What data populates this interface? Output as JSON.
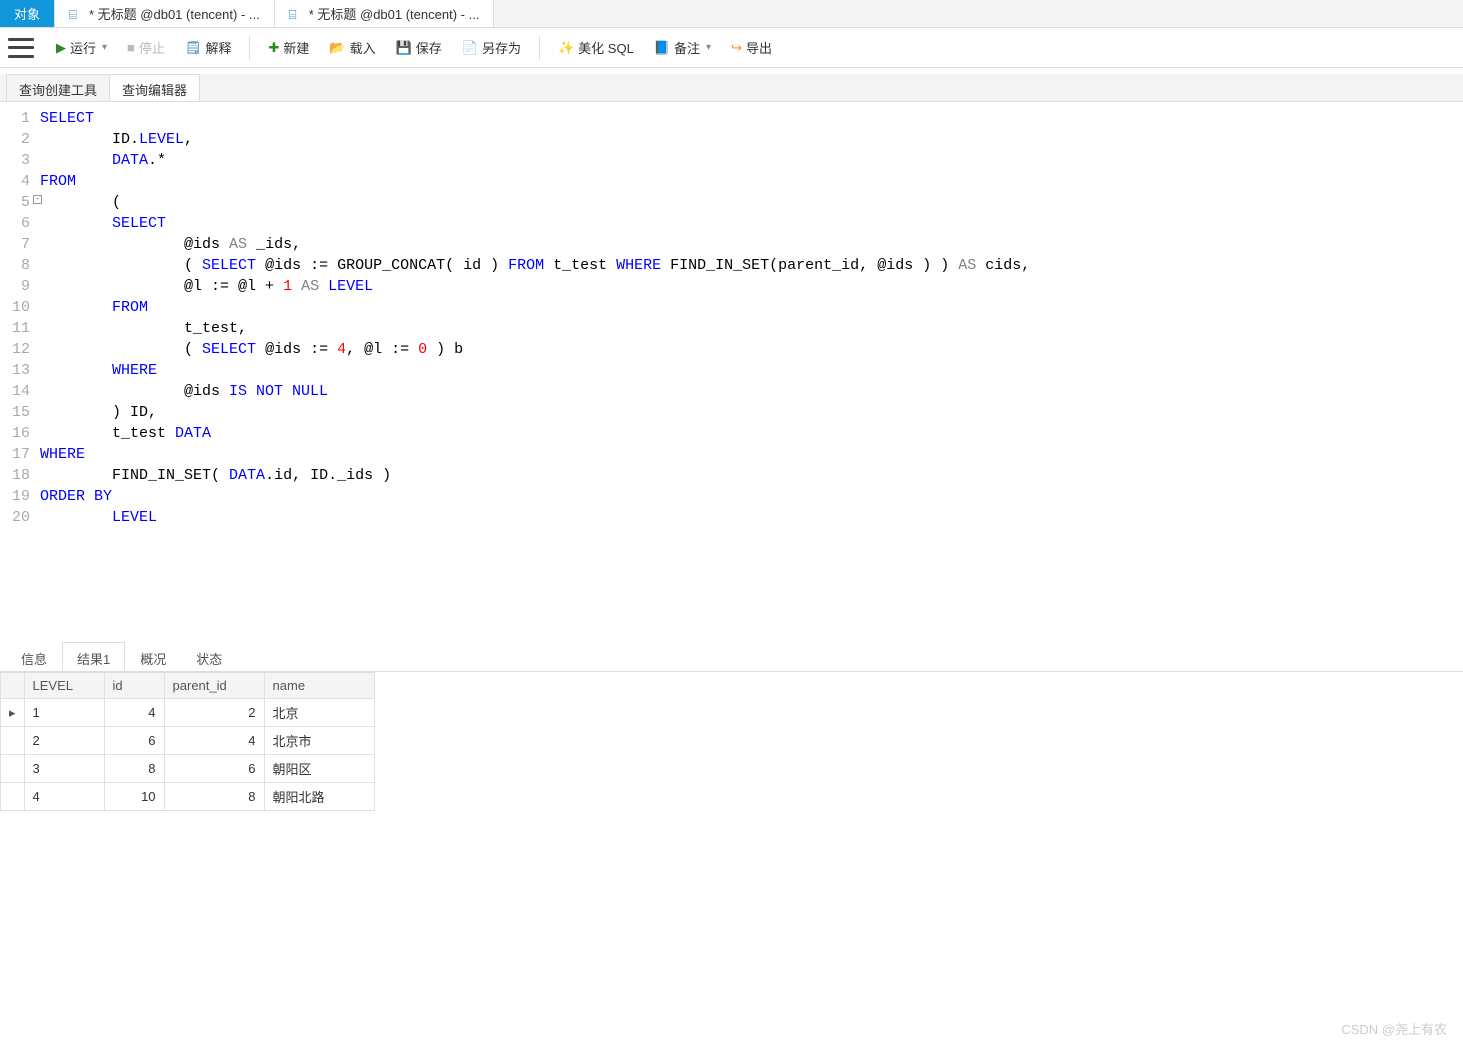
{
  "topTabs": {
    "items": [
      {
        "label": "对象",
        "active": true
      },
      {
        "label": "* 无标题 @db01 (tencent) - ...",
        "active": false
      },
      {
        "label": "* 无标题 @db01 (tencent) - ...",
        "active": false,
        "current": true
      }
    ]
  },
  "toolbar": {
    "run": "运行",
    "stop": "停止",
    "explain": "解释",
    "new": "新建",
    "load": "载入",
    "save": "保存",
    "saveAs": "另存为",
    "beautify": "美化 SQL",
    "notes": "备注",
    "export": "导出"
  },
  "subTabs": {
    "items": [
      {
        "label": "查询创建工具",
        "active": false
      },
      {
        "label": "查询编辑器",
        "active": true
      }
    ]
  },
  "editor": {
    "lines": [
      {
        "n": 1,
        "tokens": [
          [
            "kw",
            "SELECT"
          ]
        ]
      },
      {
        "n": 2,
        "tokens": [
          [
            "",
            "\tID."
          ],
          [
            "kw",
            "LEVEL"
          ],
          [
            "",
            ","
          ]
        ]
      },
      {
        "n": 3,
        "tokens": [
          [
            "",
            "\t"
          ],
          [
            "kw",
            "DATA"
          ],
          [
            "",
            ".* "
          ]
        ]
      },
      {
        "n": 4,
        "tokens": [
          [
            "kw",
            "FROM"
          ]
        ]
      },
      {
        "n": 5,
        "fold": "-",
        "tokens": [
          [
            "",
            "\t("
          ]
        ]
      },
      {
        "n": 6,
        "tokens": [
          [
            "",
            "\t"
          ],
          [
            "kw",
            "SELECT"
          ]
        ]
      },
      {
        "n": 7,
        "tokens": [
          [
            "",
            "\t\t@ids "
          ],
          [
            "grey",
            "AS"
          ],
          [
            "",
            " _ids,"
          ]
        ]
      },
      {
        "n": 8,
        "tokens": [
          [
            "",
            "\t\t( "
          ],
          [
            "kw",
            "SELECT"
          ],
          [
            "",
            " @ids := GROUP_CONCAT( id ) "
          ],
          [
            "kw",
            "FROM"
          ],
          [
            "",
            " t_test "
          ],
          [
            "kw",
            "WHERE"
          ],
          [
            "",
            " FIND_IN_SET(parent_id, @ids ) ) "
          ],
          [
            "grey",
            "AS"
          ],
          [
            "",
            " cids,"
          ]
        ]
      },
      {
        "n": 9,
        "tokens": [
          [
            "",
            "\t\t@l := @l + "
          ],
          [
            "num",
            "1"
          ],
          [
            "",
            " "
          ],
          [
            "grey",
            "AS"
          ],
          [
            "",
            " "
          ],
          [
            "kw",
            "LEVEL"
          ]
        ]
      },
      {
        "n": 10,
        "tokens": [
          [
            "",
            "\t"
          ],
          [
            "kw",
            "FROM"
          ]
        ]
      },
      {
        "n": 11,
        "tokens": [
          [
            "",
            "\t\tt_test,"
          ]
        ]
      },
      {
        "n": 12,
        "tokens": [
          [
            "",
            "\t\t( "
          ],
          [
            "kw",
            "SELECT"
          ],
          [
            "",
            " @ids := "
          ],
          [
            "num",
            "4"
          ],
          [
            "",
            ", @l := "
          ],
          [
            "num",
            "0"
          ],
          [
            "",
            " ) b"
          ]
        ]
      },
      {
        "n": 13,
        "tokens": [
          [
            "",
            "\t"
          ],
          [
            "kw",
            "WHERE"
          ]
        ]
      },
      {
        "n": 14,
        "tokens": [
          [
            "",
            "\t\t@ids "
          ],
          [
            "kw",
            "IS NOT NULL"
          ]
        ]
      },
      {
        "n": 15,
        "tokens": [
          [
            "",
            "\t) ID,"
          ]
        ]
      },
      {
        "n": 16,
        "tokens": [
          [
            "",
            "\tt_test "
          ],
          [
            "kw",
            "DATA"
          ]
        ]
      },
      {
        "n": 17,
        "tokens": [
          [
            "kw",
            "WHERE"
          ]
        ]
      },
      {
        "n": 18,
        "tokens": [
          [
            "",
            "\tFIND_IN_SET( "
          ],
          [
            "kw",
            "DATA"
          ],
          [
            "",
            ".id, ID._ids ) "
          ]
        ]
      },
      {
        "n": 19,
        "tokens": [
          [
            "kw",
            "ORDER BY"
          ]
        ]
      },
      {
        "n": 20,
        "tokens": [
          [
            "",
            "\t"
          ],
          [
            "kw",
            "LEVEL"
          ]
        ]
      }
    ]
  },
  "resultTabs": {
    "items": [
      {
        "label": "信息",
        "active": false
      },
      {
        "label": "结果1",
        "active": true
      },
      {
        "label": "概况",
        "active": false
      },
      {
        "label": "状态",
        "active": false
      }
    ]
  },
  "grid": {
    "columns": [
      "LEVEL",
      "id",
      "parent_id",
      "name"
    ],
    "rows": [
      {
        "indicator": "▸",
        "level": "1",
        "id": "4",
        "parent_id": "2",
        "name": "北京"
      },
      {
        "indicator": "",
        "level": "2",
        "id": "6",
        "parent_id": "4",
        "name": "北京市"
      },
      {
        "indicator": "",
        "level": "3",
        "id": "8",
        "parent_id": "6",
        "name": "朝阳区"
      },
      {
        "indicator": "",
        "level": "4",
        "id": "10",
        "parent_id": "8",
        "name": "朝阳北路"
      }
    ]
  },
  "watermark": "CSDN @尧上有农"
}
